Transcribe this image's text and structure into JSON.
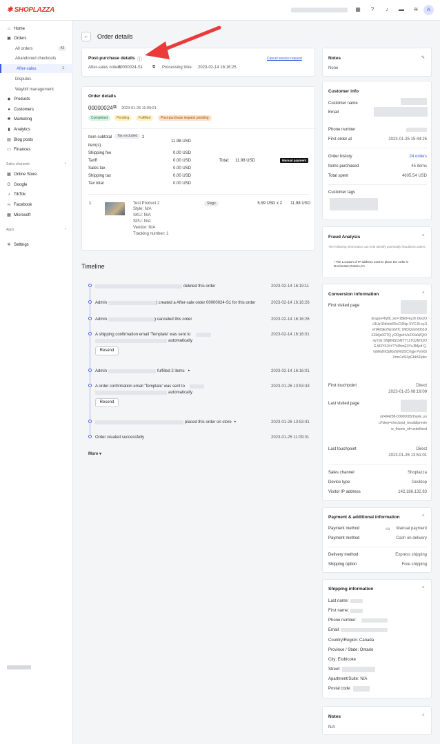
{
  "brand": {
    "logo_text": "SHOPLAZZA",
    "accent": "#3b5bdb",
    "logo_color": "#e2322a"
  },
  "topbar": {
    "icons": [
      "store-icon",
      "help-icon",
      "bell-icon",
      "chat-icon",
      "wifi-icon"
    ],
    "avatar": "A"
  },
  "sidebar": {
    "items": [
      {
        "label": "Home",
        "icon": "home-icon"
      },
      {
        "label": "Orders",
        "icon": "orders-icon"
      },
      {
        "label": "All orders",
        "badge": "43"
      },
      {
        "label": "Abandoned checkouts"
      },
      {
        "label": "After-sales",
        "badge": "1"
      },
      {
        "label": "Disputes"
      },
      {
        "label": "Waybill management"
      },
      {
        "label": "Products",
        "icon": "tag-icon"
      },
      {
        "label": "Customers",
        "icon": "person-icon"
      },
      {
        "label": "Marketing",
        "icon": "megaphone-icon"
      },
      {
        "label": "Analytics",
        "icon": "chart-icon"
      },
      {
        "label": "Blog posts",
        "icon": "blog-icon"
      },
      {
        "label": "Finances",
        "icon": "finance-icon"
      }
    ],
    "channels_label": "Sales channels",
    "channels": [
      {
        "label": "Online Store",
        "icon": "store-icon"
      },
      {
        "label": "Google",
        "icon": "google-icon"
      },
      {
        "label": "TikTok",
        "icon": "tiktok-icon"
      },
      {
        "label": "Facebook",
        "icon": "facebook-icon"
      },
      {
        "label": "Microsoft",
        "icon": "microsoft-icon"
      }
    ],
    "apps_label": "Apps",
    "settings": "Settings"
  },
  "page": {
    "title": "Order details",
    "back": "←"
  },
  "post_purchase": {
    "title": "Post-purchase details",
    "cancel_link": "Cancel service request",
    "aftersales_label": "After-sales orders:",
    "aftersales_value": "00000024-S1",
    "processing_label": "Processing time:",
    "processing_value": "2023-02-14 16:16:25"
  },
  "order": {
    "title": "Order details",
    "number": "00000024",
    "date": "2023-01-25 11:09:01",
    "statuses": [
      {
        "label": "Completed",
        "bg": "#d9f2e3",
        "fg": "#1e7a45"
      },
      {
        "label": "Pending",
        "bg": "#fdf1c5",
        "fg": "#8a6a00"
      },
      {
        "label": "Fulfilled",
        "bg": "#fdf1c5",
        "fg": "#8a6a00"
      },
      {
        "label": "Post-purchase request pending",
        "bg": "#fde2c8",
        "fg": "#9a4a00"
      }
    ],
    "subtotal_label": "Item subtotal",
    "tax_excluded": "Tax excluded",
    "item_count": "2",
    "items_word": "item(s)",
    "summary": [
      {
        "label": "",
        "value": "11.98 USD"
      },
      {
        "label": "Shipping fee",
        "value": "0.00 USD"
      },
      {
        "label": "Tariff",
        "value": "0.00 USD"
      },
      {
        "label": "Sales tax",
        "value": "0.00 USD"
      },
      {
        "label": "Shipping tax",
        "value": "0.00 USD"
      },
      {
        "label": "Tax total",
        "value": "0.00 USD"
      }
    ],
    "total_label": "Total:",
    "total_value": "11.98 USD",
    "manual_payment": "Manual payment",
    "line": {
      "qty": "1",
      "name": "Test Product 2",
      "style": "Style: N/A",
      "sku": "SKU: N/A",
      "spu": "SPU: N/A",
      "vendor": "Vendor: N/A",
      "tracking": "Tracking number: 1",
      "tag": "Stags",
      "unit": "5.99 USD x 2",
      "total": "11.98 USD"
    }
  },
  "timeline": {
    "title": "Timeline",
    "events": [
      {
        "text": "deleted this order",
        "time": "2023-02-14 16:19:11"
      },
      {
        "prefix": "Admin",
        "text": ") created a After-sale order 00000024-S1 for this order",
        "time": "2023-02-14 16:16:26"
      },
      {
        "prefix": "Admin",
        "text": ") canceled this order",
        "time": "2023-02-14 16:16:26"
      },
      {
        "text": "A shipping confirmation email 'Template' was sent to",
        "text2": "automatically",
        "time": "2023-02-14 16:16:01",
        "button": "Resend"
      },
      {
        "prefix": "Admin",
        "text": "fulfilled 2 items",
        "time": "2023-02-14 16:16:01"
      },
      {
        "text": "A order confirmation email 'Template' was sent to",
        "text2": "automatically",
        "time": "2023-01-26 13:53:43",
        "button": "Resend"
      },
      {
        "text": "placed this order on store",
        "time": "2023-01-26 13:53:41"
      },
      {
        "text": "Order created successfully",
        "time": "2023-01-25 11:09:01"
      }
    ],
    "more": "More"
  },
  "notes_top": {
    "title": "Notes",
    "value": "None"
  },
  "customer": {
    "title": "Customer info",
    "name_label": "Customer name",
    "email_label": "Email",
    "phone_label": "Phone number",
    "first_order_label": "First order at",
    "first_order_value": "2023-01-25 15:44:25",
    "history_label": "Order history",
    "history_value": "24 orders",
    "purchased_label": "Items purchased",
    "purchased_value": "45 items",
    "spent_label": "Total spent",
    "spent_value": "4605.54 USD",
    "tags_label": "Customer tags"
  },
  "fraud": {
    "title": "Fraud Analysis",
    "desc": "The following information can help identify potentially fraudulent orders",
    "bullet": "The Location of IP address used to place the order is Dorchester,Ontario,CA"
  },
  "conversion": {
    "title": "Conversion information",
    "first_page_label": "First visited page",
    "first_page_value": "dragon=flyBi_sm=1Bkit=eyJh bGciOiJIUzI1NiIsInR5cCI6Ikp XVCJ9.eyJleHAiOjE2NzIzMTc 1MDQsInN0b3JlX2lkIjo0OTQ yODgsInVzZXIiaWQiOiIyYzE SNjBNS1hNTY1LTQzMTctOG M3YS1hYTY4NmE3YzJlMjcif Q.GtWuNXSdGsWXl2OCVgje PyhX0Xmn1zSi1pGbkSDpkc",
    "first_tp_label": "First touchpoint",
    "first_tp_type": "Direct",
    "first_tp_time": "2023-01-25 08:19:09",
    "last_page_label": "Last visited page",
    "last_page_value": "ut/494288-00000005/thank_you?step=checkout_result&preview_theme_id=undefined",
    "last_tp_label": "Last touchpoint",
    "last_tp_type": "Direct",
    "last_tp_time": "2023-01-26 13:51:01",
    "channel_label": "Sales channel",
    "channel_value": "Shoplazza",
    "device_label": "Device type",
    "device_value": "Desktop",
    "ip_label": "Visitor IP address",
    "ip_value": "142.186.132.63"
  },
  "payment": {
    "title": "Payment & additional information",
    "method_label": "Payment method",
    "method_value1": "Manual payment",
    "method_value2": "Cash on delivery",
    "delivery_label": "Delivery method",
    "delivery_value": "Express shipping",
    "option_label": "Shipping option",
    "option_value": "Free shipping"
  },
  "shipping": {
    "title": "Shipping information",
    "last": "Last name:",
    "first": "First name:",
    "phone": "Phone number:",
    "email": "Email:",
    "country": "Country/Region: Canada",
    "province": "Province / State: Ontario",
    "city": "City: Etobicoke",
    "street": "Street:",
    "apt": "Apartment/Suite: N/A",
    "postal": "Postal code:"
  },
  "notes_bottom": {
    "title": "Notes",
    "value": "N/A"
  }
}
